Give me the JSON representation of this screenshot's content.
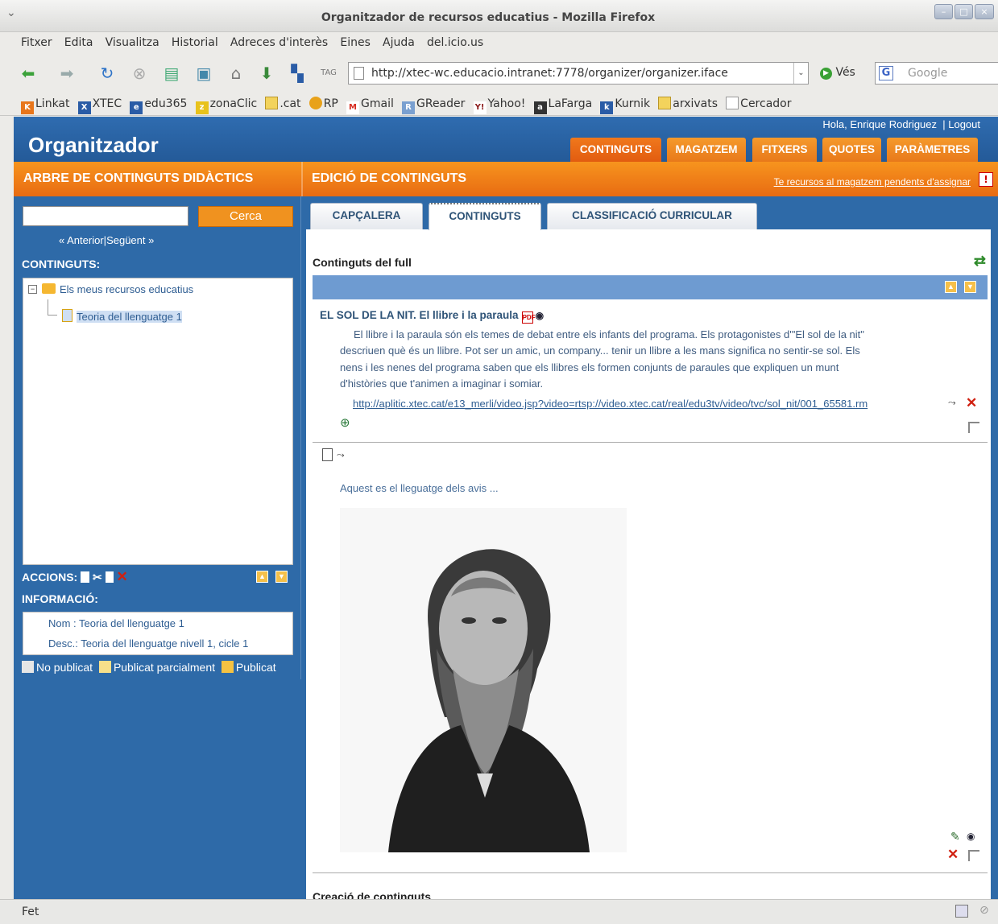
{
  "window": {
    "title": "Organitzador de recursos educatius - Mozilla Firefox"
  },
  "menu": [
    "Fitxer",
    "Edita",
    "Visualitza",
    "Historial",
    "Adreces d'interès",
    "Eines",
    "Ajuda",
    "del.icio.us"
  ],
  "nav": {
    "url": "http://xtec-wc.educacio.intranet:7778/organizer/organizer.iface",
    "go_label": "Vés",
    "search_placeholder": "Google"
  },
  "bookmarks": [
    {
      "label": "Linkat",
      "icon": "k-icon",
      "color": "#e8761b"
    },
    {
      "label": "XTEC",
      "icon": "x-icon",
      "color": "#2a5ca6"
    },
    {
      "label": "edu365",
      "icon": "e-icon",
      "color": "#2a5ca6"
    },
    {
      "label": "zonaClic",
      "icon": "zona-icon",
      "color": "#e8c21b"
    },
    {
      "label": ".cat",
      "icon": "folder-icon",
      "color": "#f3d35c"
    },
    {
      "label": "RP",
      "icon": "globe-icon",
      "color": "#e8a21b"
    },
    {
      "label": "Gmail",
      "icon": "m-icon",
      "color": "#d62b1f"
    },
    {
      "label": "GReader",
      "icon": "feed-icon",
      "color": "#7aa0d0"
    },
    {
      "label": "Yahoo!",
      "icon": "y-icon",
      "color": "#8b1b1b"
    },
    {
      "label": "LaFarga",
      "icon": "la-icon",
      "color": "#333333"
    },
    {
      "label": "Kurnik",
      "icon": "k-icon",
      "color": "#2a5ca6"
    },
    {
      "label": "arxivats",
      "icon": "folder-icon",
      "color": "#f3d35c"
    },
    {
      "label": "Cercador",
      "icon": "page-icon",
      "color": "#ffffff"
    }
  ],
  "app": {
    "logo": "Organitzador",
    "greeting": "Hola, Enrique Rodriguez",
    "logout": "Logout",
    "top_tabs": [
      "CONTINGUTS",
      "MAGATZEM",
      "FITXERS",
      "QUOTES",
      "PARÀMETRES"
    ],
    "left_title": "ARBRE DE CONTINGUTS DIDÀCTICS",
    "right_title": "EDICIÓ DE CONTINGUTS",
    "pending_link": "Te recursos al magatzem pendents d'assignar",
    "search_button": "Cerca",
    "pager_prev": "Anterior",
    "pager_next": "Següent",
    "contents_label": "CONTINGUTS:",
    "tree": {
      "root": "Els meus recursos educatius",
      "child": "Teoria del llenguatge 1"
    },
    "actions_label": "ACCIONS:",
    "info_label": "INFORMACIÓ:",
    "info": {
      "nom": "Nom : Teoria del llenguatge 1",
      "desc": "Desc.: Teoria del llenguatge nivell 1, cicle 1"
    },
    "legend": [
      {
        "label": "No publicat",
        "color": "#e6e6e6"
      },
      {
        "label": "Publicat parcialment",
        "color": "#f7e08a"
      },
      {
        "label": "Publicat",
        "color": "#f5c242"
      }
    ],
    "sub_tabs": [
      "CAPÇALERA",
      "CONTINGUTS",
      "CLASSIFICACIÓ CURRICULAR"
    ],
    "sheet_title": "Continguts del full",
    "item1": {
      "title": "EL SOL DE LA NIT. El llibre i la paraula",
      "desc_lines": [
        "El llibre i la paraula són els temes de debat entre els infants del programa. Els protagonistes d'\"El sol de la nit\"",
        "descriuen què és un llibre. Pot ser un amic, un company... tenir un llibre a les mans significa no sentir-se sol. Els",
        "nens i les nenes del programa saben que els llibres els formen conjunts de paraules que expliquen un munt",
        "d'històries que t'animen a imaginar i somiar."
      ],
      "link": "http://aplitic.xtec.cat/e13_merli/video.jsp?video=rtsp://video.xtec.cat/real/edu3tv/video/tvc/sol_nit/001_65581.rm"
    },
    "item2": {
      "text": "Aquest es el lleguatge dels avis ..."
    },
    "bottom_heading": "Creació de continguts"
  },
  "status": {
    "text": "Fet"
  }
}
